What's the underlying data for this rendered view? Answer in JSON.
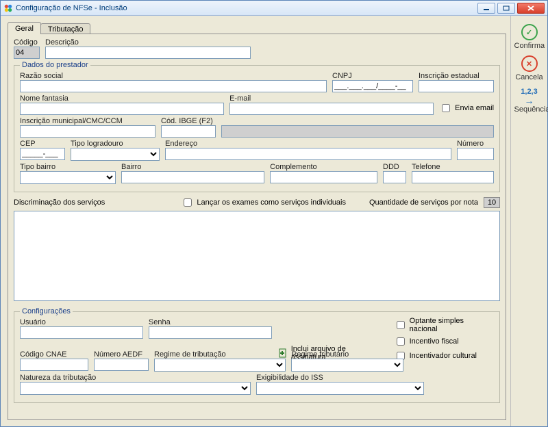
{
  "window": {
    "title": "Configuração de NFSe - Inclusão"
  },
  "tabs": {
    "geral": "Geral",
    "tributacao": "Tributação"
  },
  "header": {
    "codigo_label": "Código",
    "codigo_value": "04",
    "descricao_label": "Descrição",
    "descricao_value": ""
  },
  "prestador": {
    "legend": "Dados do prestador",
    "razao_label": "Razão social",
    "cnpj_label": "CNPJ",
    "cnpj_mask": "___.___.___/____-__",
    "ie_label": "Inscrição estadual",
    "nome_fantasia_label": "Nome fantasia",
    "email_label": "E-mail",
    "envia_email_label": "Envia email",
    "im_label": "Inscrição municipal/CMC/CCM",
    "ibge_label": "Cód. IBGE (F2)",
    "cep_label": "CEP",
    "cep_mask": "_____-___",
    "tipo_logradouro_label": "Tipo logradouro",
    "endereco_label": "Endereço",
    "numero_label": "Número",
    "tipo_bairro_label": "Tipo bairro",
    "bairro_label": "Bairro",
    "complemento_label": "Complemento",
    "ddd_label": "DDD",
    "telefone_label": "Telefone"
  },
  "discriminacao": {
    "label": "Discriminação dos serviços",
    "lancar_label": "Lançar os exames como serviços individuais",
    "qtd_label": "Quantidade de serviços por nota",
    "qtd_value": "10"
  },
  "config": {
    "legend": "Configurações",
    "usuario_label": "Usuário",
    "senha_label": "Senha",
    "inclui_assinatura_label": "Inclui arquivo de assinatura",
    "optante_label": "Optante simples nacional",
    "incentivo_label": "Incentivo fiscal",
    "incentivador_label": "Incentivador cultural",
    "cnae_label": "Código CNAE",
    "aedf_label": "Número AEDF",
    "regime_trib_label": "Regime de tributação",
    "regime_tributario_label": "Regime tributário",
    "natureza_label": "Natureza da tributação",
    "exigibilidade_label": "Exigibilidade do ISS"
  },
  "side": {
    "confirma": "Confirma",
    "cancela": "Cancela",
    "sequencia": "Sequência",
    "seq_digits": "1,2,3"
  }
}
